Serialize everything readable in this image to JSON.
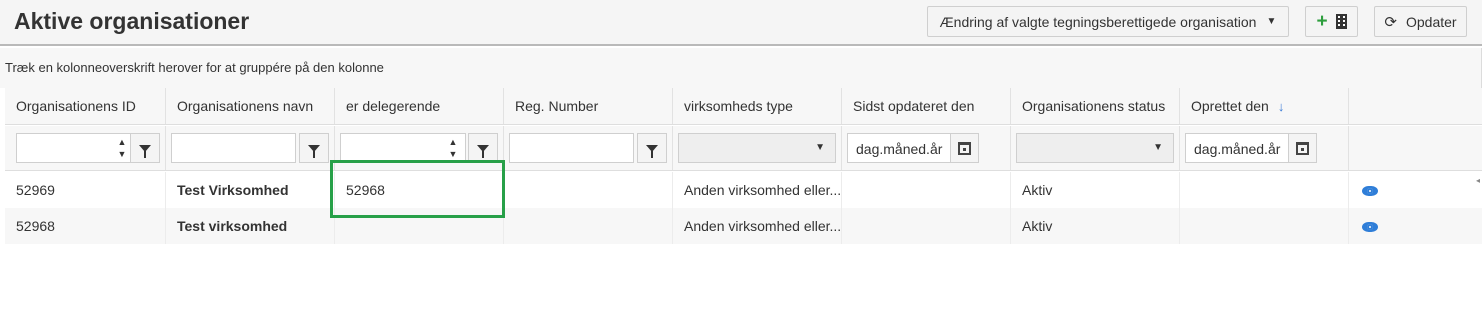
{
  "header": {
    "title": "Aktive organisationer",
    "dropdown_label": "Ændring af valgte tegningsberettigede organisation",
    "refresh_label": "Opdater",
    "icons": {
      "add": "plus-icon",
      "org": "building-icon",
      "refresh": "refresh-icon",
      "caret": "caret-down-icon"
    },
    "add_color": "#2e9e3e"
  },
  "group_panel": {
    "text": "Træk en kolonneoverskrift herover for at gruppére på den kolonne"
  },
  "columns": [
    "Organisationens ID",
    "Organisationens navn",
    "er delegerende",
    "Reg. Number",
    "virksomheds type",
    "Sidst opdateret den",
    "Organisationens status",
    "Oprettet den"
  ],
  "filters": {
    "date_placeholder_1": "dag.måned.år",
    "date_placeholder_2": "dag.måned.år"
  },
  "rows": [
    {
      "id": "52969",
      "name": "Test Virksomhed",
      "delegating": "52968",
      "reg": "",
      "type": "Anden virksomhed eller...",
      "updated": "",
      "status": "Aktiv",
      "created": ""
    },
    {
      "id": "52968",
      "name": "Test virksomhed",
      "delegating": "",
      "reg": "",
      "type": "Anden virksomhed eller...",
      "updated": "",
      "status": "Aktiv",
      "created": ""
    }
  ],
  "highlight_color": "#27a048",
  "accent_color": "#2f7ed8"
}
